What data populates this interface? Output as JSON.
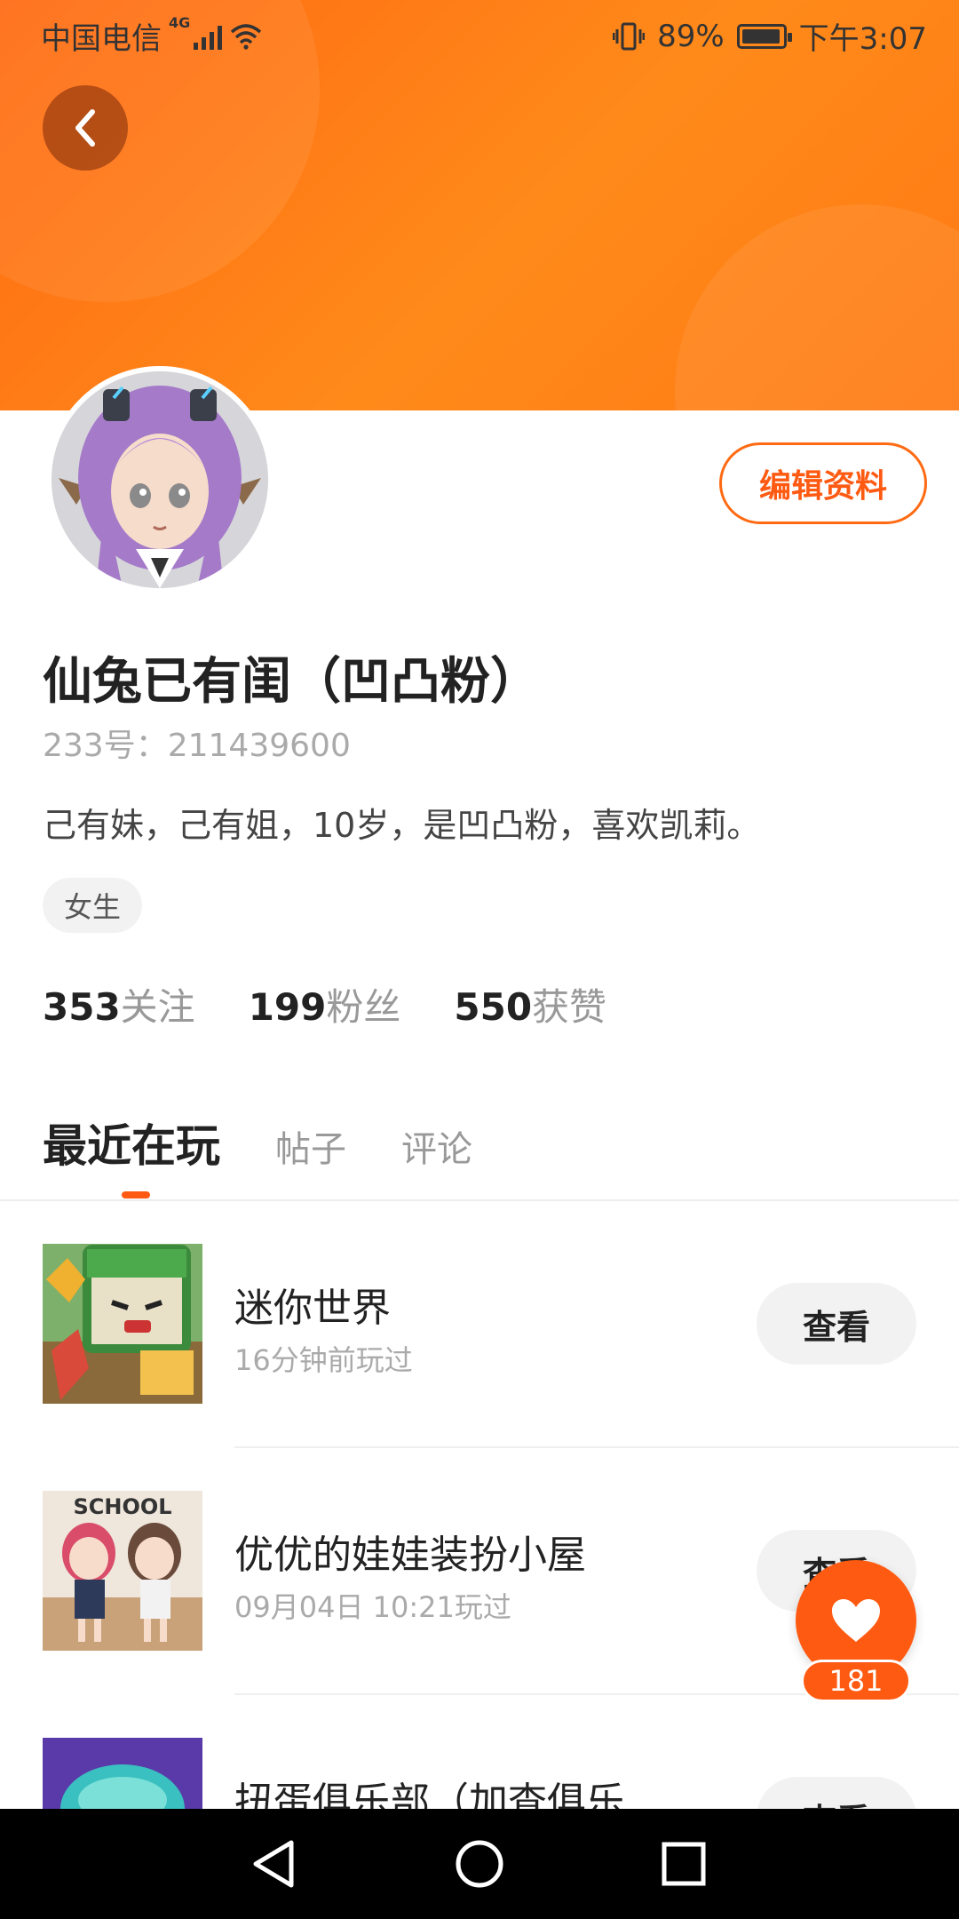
{
  "status_bar": {
    "carrier": "中国电信",
    "network": "4G",
    "battery": "89%",
    "time": "下午3:07"
  },
  "profile": {
    "edit_label": "编辑资料",
    "username": "仙兔已有闺（凹凸粉）",
    "user_id": "233号：211439600",
    "bio": "己有妹，己有姐，10岁，是凹凸粉，喜欢凯莉。",
    "gender": "女生"
  },
  "stats": {
    "following_count": "353",
    "following_label": "关注",
    "followers_count": "199",
    "followers_label": "粉丝",
    "likes_count": "550",
    "likes_label": "获赞"
  },
  "tabs": [
    {
      "label": "最近在玩"
    },
    {
      "label": "帖子"
    },
    {
      "label": "评论"
    }
  ],
  "games": [
    {
      "title": "迷你世界",
      "time": "16分钟前玩过",
      "view_label": "查看"
    },
    {
      "title": "优优的娃娃装扮小屋",
      "time": "09月04日 10:21玩过",
      "view_label": "查看",
      "thumb_text": "SCHOOL"
    },
    {
      "title": "扭蛋俱乐部（加查俱乐...",
      "time": "",
      "view_label": "查看"
    }
  ],
  "like_button": {
    "count": "181"
  },
  "colors": {
    "accent": "#ff5a12",
    "header": "#ff7a14"
  }
}
